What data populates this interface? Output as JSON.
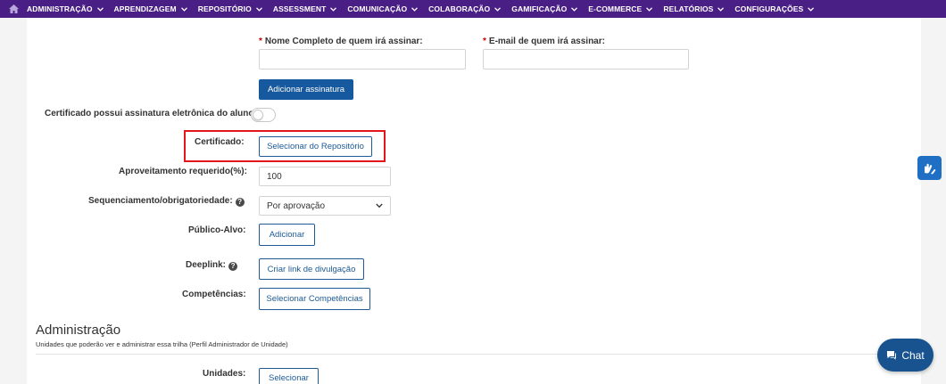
{
  "nav": {
    "items": [
      {
        "label": "ADMINISTRAÇÃO"
      },
      {
        "label": "APRENDIZAGEM"
      },
      {
        "label": "REPOSITÓRIO"
      },
      {
        "label": "ASSESSMENT"
      },
      {
        "label": "COMUNICAÇÃO"
      },
      {
        "label": "COLABORAÇÃO"
      },
      {
        "label": "GAMIFICAÇÃO"
      },
      {
        "label": "E-COMMERCE"
      },
      {
        "label": "RELATÓRIOS"
      },
      {
        "label": "CONFIGURAÇÕES"
      }
    ]
  },
  "signature": {
    "required_mark": "*",
    "name_label": "Nome Completo de quem irá assinar:",
    "email_label": "E-mail de quem irá assinar:",
    "name_value": "",
    "email_value": "",
    "add_button": "Adicionar assinatura"
  },
  "form": {
    "electronic_signature_label": "Certificado possui assinatura eletrônica do aluno:",
    "certificate_label": "Certificado:",
    "certificate_button": "Selecionar do Repositório",
    "score_label": "Aproveitamento requerido(%):",
    "score_value": "100",
    "sequencing_label": "Sequenciamento/obrigatoriedade:",
    "sequencing_value": "Por aprovação",
    "audience_label": "Público-Alvo:",
    "audience_button": "Adicionar",
    "deeplink_label": "Deeplink:",
    "deeplink_button": "Criar link de divulgação",
    "competencies_label": "Competências:",
    "competencies_button": "Selecionar Competências"
  },
  "admin": {
    "title": "Administração",
    "subtitle": "Unidades que poderão ver e administrar essa trilha (Perfil Administrador de Unidade)",
    "units_label": "Unidades:",
    "units_button": "Selecionar"
  },
  "chat": {
    "label": "Chat"
  },
  "colors": {
    "nav_bg": "#4a1f85",
    "primary": "#17599e",
    "highlight": "#e3161c",
    "chat_bg": "#18538f"
  }
}
